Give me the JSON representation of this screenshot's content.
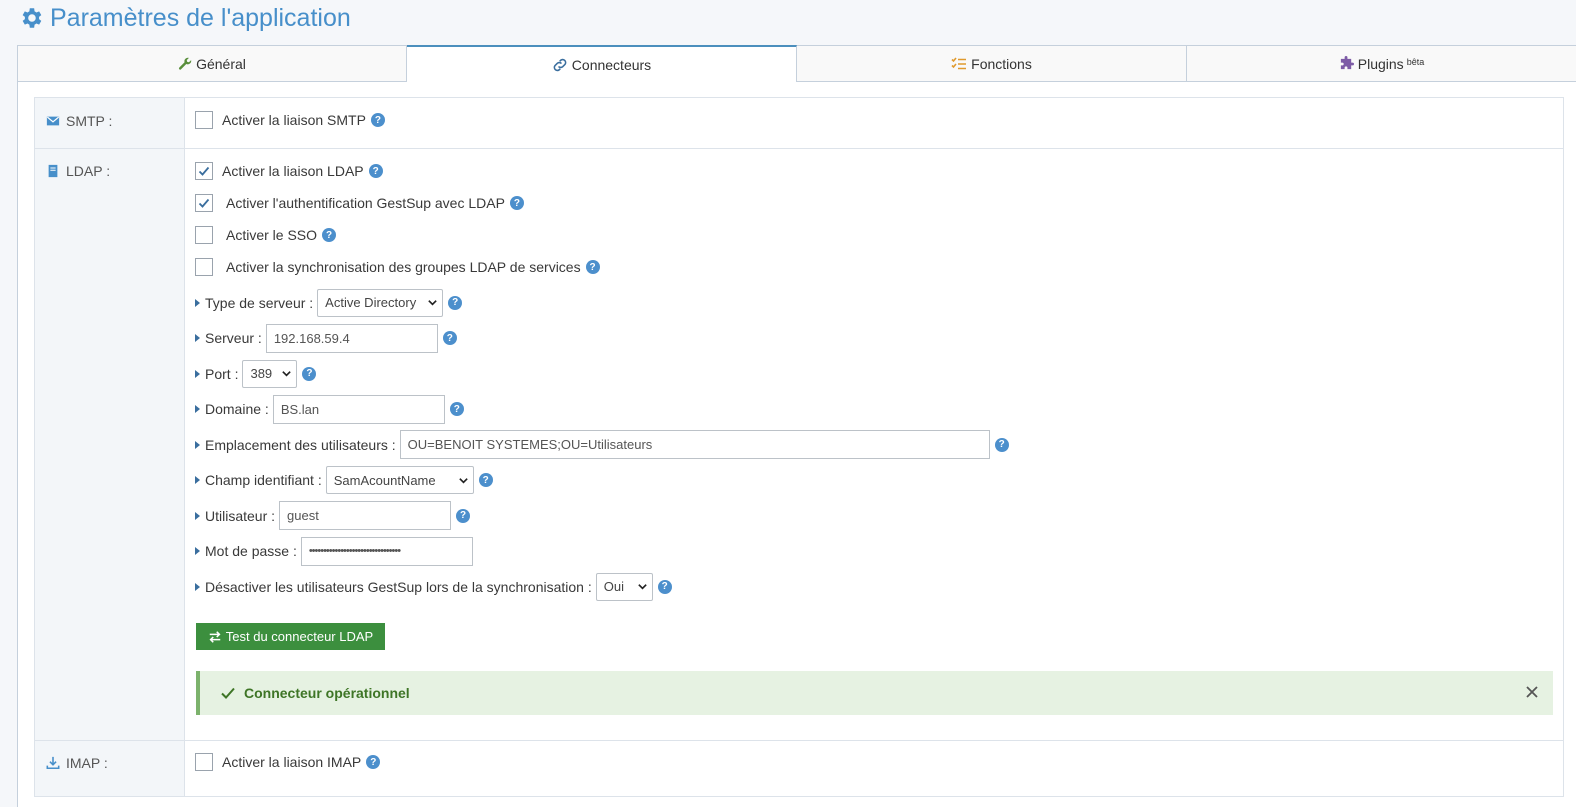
{
  "page": {
    "title": "Paramètres de l'application",
    "icon": "gear-icon"
  },
  "tabs": [
    {
      "label": "Général",
      "icon": "wrench-icon",
      "active": false
    },
    {
      "label": "Connecteurs",
      "icon": "link-icon",
      "active": true
    },
    {
      "label": "Fonctions",
      "icon": "list-check-icon",
      "active": false
    },
    {
      "label": "Plugins",
      "sup": "bêta",
      "icon": "puzzle-icon",
      "active": false
    }
  ],
  "smtp": {
    "label": "SMTP :",
    "enable": {
      "label": "Activer la liaison SMTP",
      "checked": false
    }
  },
  "ldap": {
    "label": "LDAP :",
    "checks": [
      {
        "label": "Activer la liaison LDAP",
        "checked": true
      },
      {
        "label": "Activer l'authentification GestSup avec LDAP",
        "checked": true
      },
      {
        "label": "Activer le SSO",
        "checked": false
      },
      {
        "label": "Activer la synchronisation des groupes LDAP de services",
        "checked": false
      }
    ],
    "fields": {
      "server_type": {
        "label": "Type de serveur :",
        "value": "Active Directory"
      },
      "server": {
        "label": "Serveur :",
        "value": "192.168.59.4"
      },
      "port": {
        "label": "Port :",
        "value": "389"
      },
      "domain": {
        "label": "Domaine :",
        "value": "BS.lan"
      },
      "users_location": {
        "label": "Emplacement des utilisateurs :",
        "value": "OU=BENOIT SYSTEMES;OU=Utilisateurs"
      },
      "id_field": {
        "label": "Champ identifiant :",
        "value": "SamAcountName"
      },
      "user": {
        "label": "Utilisateur :",
        "value": "guest"
      },
      "password": {
        "label": "Mot de passe :",
        "value": "••••••••••••••••••••••••••••••••"
      },
      "disable_users": {
        "label": "Désactiver les utilisateurs GestSup lors de la synchronisation :",
        "value": "Oui"
      }
    },
    "test_button": "Test du connecteur LDAP",
    "alert": "Connecteur opérationnel"
  },
  "imap": {
    "label": "IMAP :",
    "enable": {
      "label": "Activer la liaison IMAP",
      "checked": false
    }
  },
  "colors": {
    "accent": "#478fca",
    "success": "#3c8f3e",
    "help": "#4c8fcc"
  }
}
